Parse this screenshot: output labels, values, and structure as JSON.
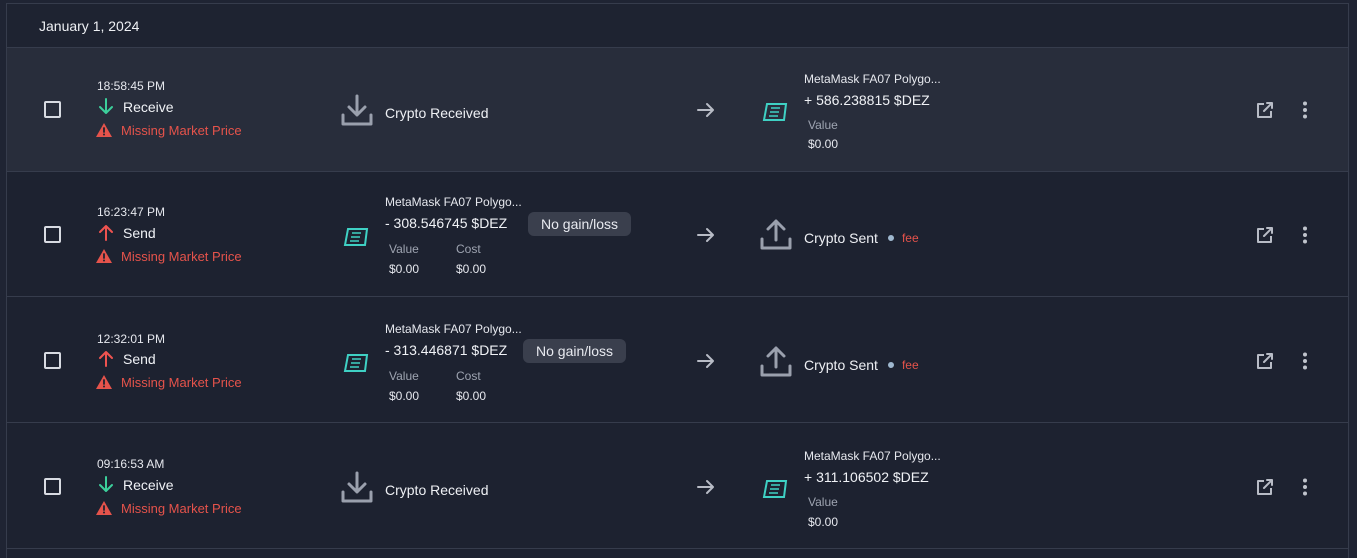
{
  "date_header": "January 1, 2024",
  "colors": {
    "receive": "#3ccf9b",
    "send": "#ef5350",
    "warning": "#e5534b",
    "token": "#3fd1c4"
  },
  "rows": [
    {
      "time": "18:58:45 PM",
      "type": "Receive",
      "warning": "Missing Market Price",
      "left_label": "Crypto Received",
      "account": "MetaMask FA07 Polygo...",
      "amount": "+ 586.238815 $DEZ",
      "value_label": "Value",
      "value": "$0.00"
    },
    {
      "time": "16:23:47 PM",
      "type": "Send",
      "warning": "Missing Market Price",
      "account": "MetaMask FA07 Polygo...",
      "amount": "- 308.546745 $DEZ",
      "badge": "No gain/loss",
      "value_label": "Value",
      "value": "$0.00",
      "cost_label": "Cost",
      "cost": "$0.00",
      "right_label": "Crypto Sent",
      "fee": "fee"
    },
    {
      "time": "12:32:01 PM",
      "type": "Send",
      "warning": "Missing Market Price",
      "account": "MetaMask FA07 Polygo...",
      "amount": "- 313.446871 $DEZ",
      "badge": "No gain/loss",
      "value_label": "Value",
      "value": "$0.00",
      "cost_label": "Cost",
      "cost": "$0.00",
      "right_label": "Crypto Sent",
      "fee": "fee"
    },
    {
      "time": "09:16:53 AM",
      "type": "Receive",
      "warning": "Missing Market Price",
      "left_label": "Crypto Received",
      "account": "MetaMask FA07 Polygo...",
      "amount": "+ 311.106502 $DEZ",
      "value_label": "Value",
      "value": "$0.00"
    }
  ]
}
